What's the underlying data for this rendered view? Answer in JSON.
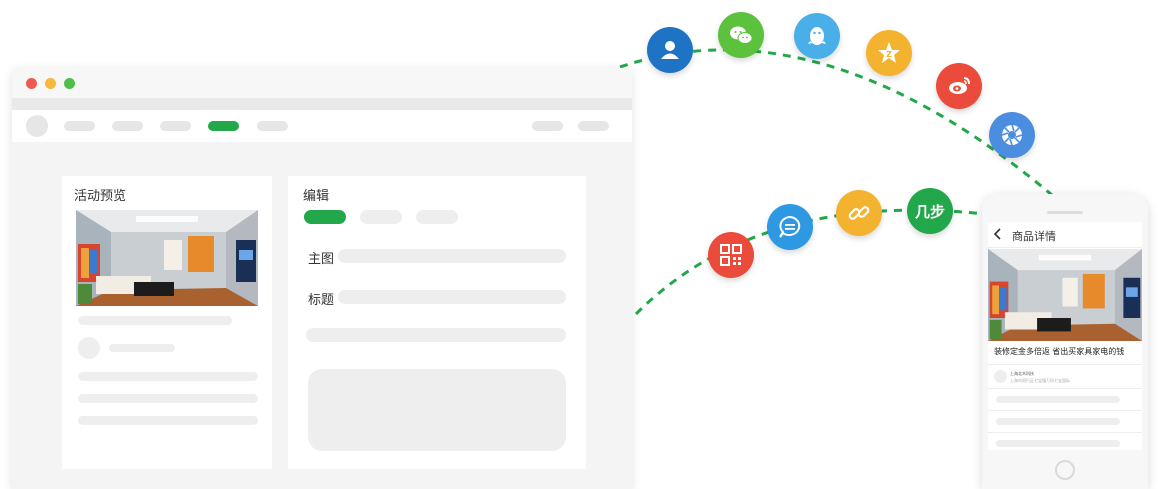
{
  "desktop": {
    "preview_panel": {
      "title": "活动预览"
    },
    "edit_panel": {
      "title": "编辑",
      "fields": [
        {
          "label": "主图"
        },
        {
          "label": "标题"
        }
      ]
    },
    "colors": {
      "accent": "#22a84a",
      "skeleton": "#eeeeee",
      "window_bg": "#f4f4f4"
    }
  },
  "share_channels": [
    {
      "name": "contacts",
      "icon": "user-icon",
      "color": "#1f73c4"
    },
    {
      "name": "wechat",
      "icon": "wechat-icon",
      "color": "#5cc13d"
    },
    {
      "name": "qq",
      "icon": "qq-penguin-icon",
      "color": "#4aaee9"
    },
    {
      "name": "qzone",
      "icon": "qzone-star-icon",
      "color": "#f3b32f"
    },
    {
      "name": "weibo",
      "icon": "weibo-icon",
      "color": "#ea4b3a"
    },
    {
      "name": "moments",
      "icon": "camera-aperture-icon",
      "color": "#4b8ee0"
    },
    {
      "name": "qr",
      "icon": "qr-code-icon",
      "color": "#ea4b3a"
    },
    {
      "name": "sms",
      "icon": "message-bubble-icon",
      "color": "#2f98e2"
    },
    {
      "name": "link",
      "icon": "link-chain-icon",
      "color": "#f3b32f"
    },
    {
      "name": "jibu",
      "icon": "jibu-logo-icon",
      "color": "#22a84a",
      "text": "几步"
    }
  ],
  "phone": {
    "header_title": "商品详情",
    "caption": "装修定金多倍返 省出买家具家电的钱",
    "author": "上海北木科技",
    "address": "上海市闵行区七宝镇万科七宝国际"
  }
}
